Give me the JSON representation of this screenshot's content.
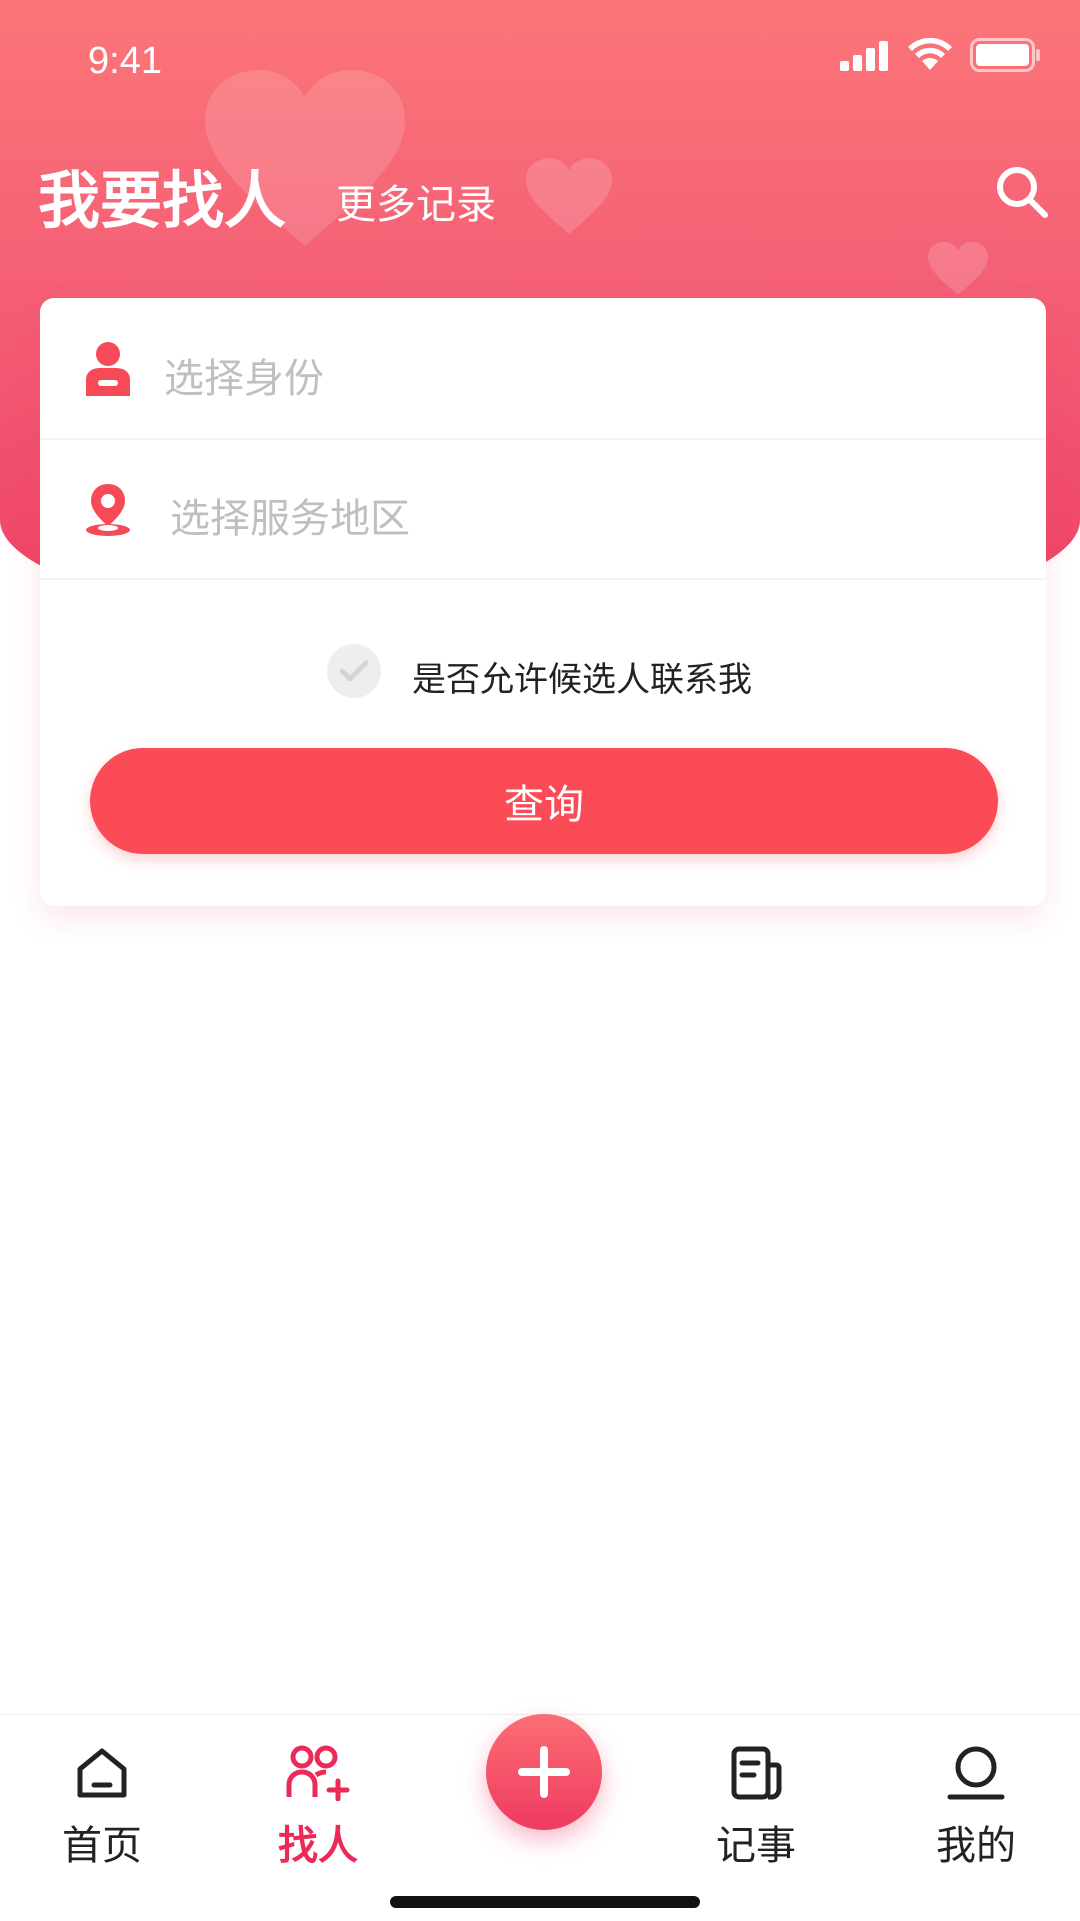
{
  "status_bar": {
    "time": "9:41"
  },
  "header": {
    "title": "我要找人",
    "more_link": "更多记录"
  },
  "form": {
    "identity_placeholder": "选择身份",
    "region_placeholder": "选择服务地区",
    "allow_contact_label": "是否允许候选人联系我",
    "allow_contact_checked": false,
    "query_button": "查询"
  },
  "tabbar": {
    "items": [
      {
        "label": "首页",
        "icon": "home-icon",
        "active": false
      },
      {
        "label": "找人",
        "icon": "find-people-icon",
        "active": true
      },
      {
        "label": "",
        "icon": "plus-icon",
        "active": false
      },
      {
        "label": "记事",
        "icon": "notes-icon",
        "active": false
      },
      {
        "label": "我的",
        "icon": "profile-icon",
        "active": false
      }
    ]
  },
  "colors": {
    "accent": "#fb4b57",
    "active_tab": "#ec2a58",
    "header_gradient_top": "#fb7678",
    "header_gradient_bottom": "#ee3f63"
  }
}
